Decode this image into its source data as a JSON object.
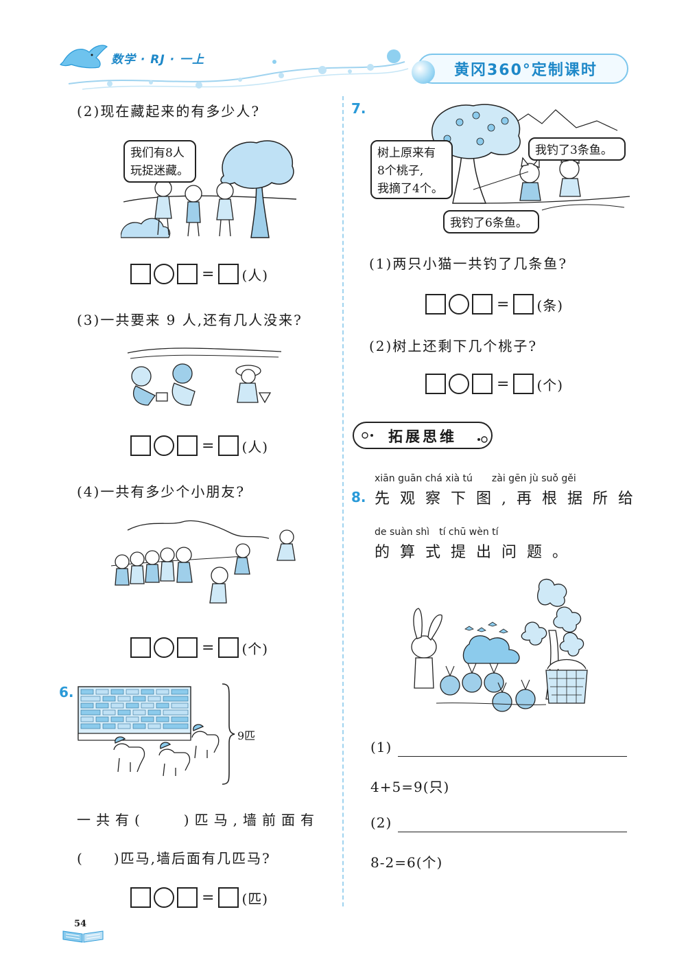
{
  "header": {
    "subject": "数学 · RJ · 一上",
    "brand": "黄冈360°定制课时"
  },
  "left": {
    "q2": {
      "text": "(2)现在藏起来的有多少人?",
      "bubble_line1": "我们有8人",
      "bubble_line2": "玩捉迷藏。",
      "unit": "(人)"
    },
    "q3": {
      "text": "(3)一共要来 9 人,还有几人没来?",
      "unit": "(人)"
    },
    "q4": {
      "text": "(4)一共有多少个小朋友?",
      "unit": "(个)"
    },
    "q6": {
      "num": "6.",
      "brace_label": "9匹",
      "line1": "一共有(　　)匹马,墙前面有",
      "line2": "(　　)匹马,墙后面有几匹马?",
      "unit": "(匹)"
    }
  },
  "right": {
    "q7": {
      "num": "7.",
      "bubble_tree_line1": "树上原来有",
      "bubble_tree_line2": "8个桃子,",
      "bubble_tree_line3": "我摘了4个。",
      "bubble_cat1": "我钓了3条鱼。",
      "bubble_cat2": "我钓了6条鱼。",
      "sub1": "(1)两只小猫一共钓了几条鱼?",
      "unit1": "(条)",
      "sub2": "(2)树上还剩下几个桃子?",
      "unit2": "(个)"
    },
    "section_title": "拓展思维",
    "q8": {
      "num": "8.",
      "pinyin1": "xiān guān chá xià tú　　zài gēn jù suǒ gěi",
      "hanzi1": "先观察下图,再根据所给",
      "pinyin2": "de suàn shì　tí chū wèn tí",
      "hanzi2": "的算式提出问题。",
      "a1_label": "(1)",
      "a1_formula": "4+5=9(只)",
      "a2_label": "(2)",
      "a2_formula": "8-2=6(个)"
    }
  },
  "footer": {
    "page_number": "54"
  },
  "colors": {
    "accent": "#2a9ad8",
    "light_blue": "#9fd3ef",
    "ink": "#1a1a1a"
  }
}
